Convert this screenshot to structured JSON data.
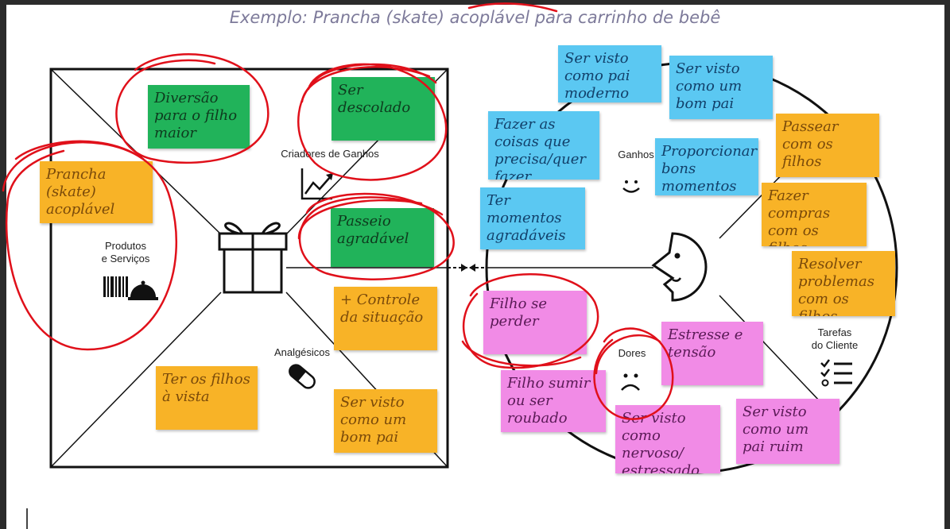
{
  "title": "Exemplo: Prancha (skate) acoplável para carrinho de bebê",
  "product_side": {
    "products_label": "Produtos\ne Serviços",
    "gain_creators_label": "Criadores de Ganhos",
    "pain_relievers_label": "Analgésicos",
    "notes": {
      "diversao": "Diversão para o filho maior",
      "descolado": "Ser descolado",
      "prancha": "Prancha (skate) acoplável",
      "passeio": "Passeio agradável",
      "controle": "+ Controle da situação",
      "filhos_vista": "Ter os filhos à vista",
      "bom_pai_left": "Ser visto como um bom pai"
    }
  },
  "customer_side": {
    "gains_label": "Ganhos",
    "pains_label": "Dores",
    "jobs_label": "Tarefas\ndo Cliente",
    "notes": {
      "pai_moderno": "Ser visto como pai moderno",
      "bom_pai_right": "Ser visto como um bom pai",
      "fazer_coisas": "Fazer as coisas que precisa/quer fazer",
      "momentos_bons": "Proporcionar bons momentos",
      "momentos_agradaveis": "Ter momentos agradáveis",
      "passear": "Passear com os filhos",
      "compras": "Fazer compras com os filhos",
      "resolver": "Resolver problemas com os filhos",
      "filho_perder": "Filho se perder",
      "estresse": "Estresse e tensão",
      "filho_sumir": "Filho sumir ou ser roubado",
      "nervoso": "Ser visto como nervoso/ estressado",
      "pai_ruim": "Ser visto como um pai ruim"
    }
  },
  "colors": {
    "green": "#21b35a",
    "yellow": "#f8b327",
    "blue": "#5bc8f2",
    "pink": "#f18be6",
    "annotation_red": "#e0101a"
  },
  "icons": [
    "gift-icon",
    "growth-chart-icon",
    "barcode-icon",
    "service-bell-icon",
    "pill-icon",
    "smiley-face-icon",
    "sad-face-icon",
    "checklist-icon",
    "customer-face-icon"
  ]
}
